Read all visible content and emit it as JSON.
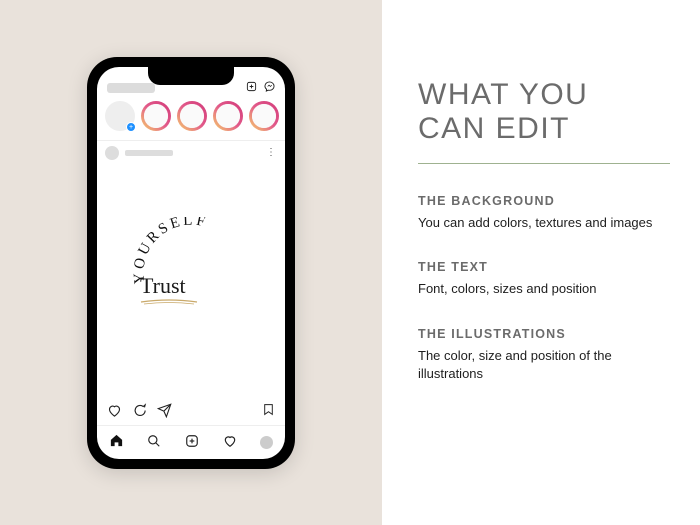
{
  "right": {
    "heading_line1": "WHAT YOU",
    "heading_line2": "CAN EDIT",
    "sections": [
      {
        "title": "THE BACKGROUND",
        "body": "You can add colors, textures and images"
      },
      {
        "title": "THE TEXT",
        "body": "Font, colors, sizes and position"
      },
      {
        "title": "THE ILLUSTRATIONS",
        "body": "The color, size and position of the illustrations"
      }
    ]
  },
  "phone": {
    "post_art": {
      "script_word": "Trust",
      "curved_word": "YOURSELF"
    }
  }
}
